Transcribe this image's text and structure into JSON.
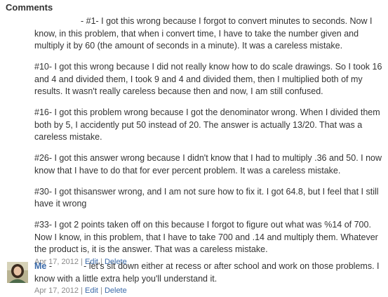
{
  "header": {
    "title": "Comments"
  },
  "comment": {
    "paragraphs": [
      "- #1- I got this wrong because I forgot to convert minutes to seconds. Now I know, in this problem, that when i convert time, I have to take the number given and multiply it by 60 (the amount of seconds in a minute). It was a careless mistake.",
      "#10- I got this wrong because I did not really know how to do scale drawings. So I took 16 and 4 and divided them, I took 9 and 4 and divided them, then I multiplied both of my results. It wasn't really careless because then and now, I am still confused.",
      "#16- I got this problem wrong because I got the denominator wrong. When I divided them both by 5, I accidently put 50 instead of 20. The answer is actually 13/20. That was a careless mistake.",
      "#26- I got this answer wrong because I didn't know that I had to multiply .36 and 50. I now know that I have to do that for ever percent problem. It was a careless mistake.",
      "#30- I got thisanswer wrong, and I am not sure how to fix it. I got 64.8, but I feel that I still have it wrong",
      "#33- I got 2 points taken off on this because I forgot to figure out what was %14 of 700. Now I know, in this problem, that I have to take 700 and .14 and multiply them. Whatever the product is, it is the answer. That was a careless mistake."
    ],
    "date": "Apr 17, 2012",
    "separator": "|",
    "edit_label": "Edit",
    "delete_label": "Delete"
  },
  "reply": {
    "author": "Me",
    "text": " -             - let's sit down either at recess or after school and work on those problems. I know with a little extra help you'll understand it.",
    "date": "Apr 17, 2012",
    "separator": "|",
    "edit_label": "Edit",
    "delete_label": "Delete",
    "avatar_icon": "person-photo-icon"
  },
  "colors": {
    "link": "#3b6aa8",
    "text": "#333333",
    "meta": "#888888"
  }
}
